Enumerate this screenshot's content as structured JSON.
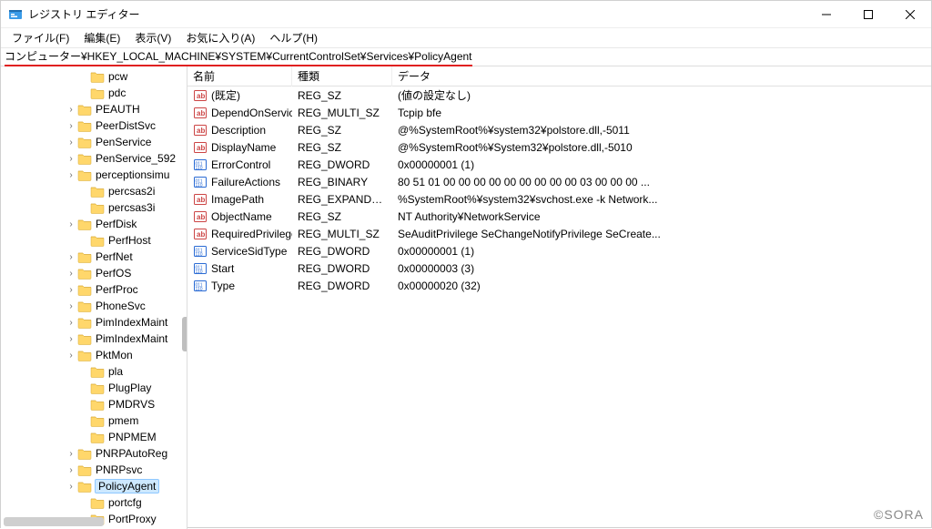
{
  "window": {
    "title": "レジストリ エディター"
  },
  "menu": {
    "file": "ファイル(F)",
    "edit": "編集(E)",
    "view": "表示(V)",
    "fav": "お気に入り(A)",
    "help": "ヘルプ(H)"
  },
  "address": "コンピューター¥HKEY_LOCAL_MACHINE¥SYSTEM¥CurrentControlSet¥Services¥PolicyAgent",
  "tree": [
    {
      "label": "pcw",
      "depth": 3,
      "chevron": ""
    },
    {
      "label": "pdc",
      "depth": 3,
      "chevron": ""
    },
    {
      "label": "PEAUTH",
      "depth": 2,
      "chevron": ">"
    },
    {
      "label": "PeerDistSvc",
      "depth": 2,
      "chevron": ">"
    },
    {
      "label": "PenService",
      "depth": 2,
      "chevron": ">"
    },
    {
      "label": "PenService_592",
      "depth": 2,
      "chevron": ">"
    },
    {
      "label": "perceptionsimu",
      "depth": 2,
      "chevron": ">"
    },
    {
      "label": "percsas2i",
      "depth": 3,
      "chevron": ""
    },
    {
      "label": "percsas3i",
      "depth": 3,
      "chevron": ""
    },
    {
      "label": "PerfDisk",
      "depth": 2,
      "chevron": ">"
    },
    {
      "label": "PerfHost",
      "depth": 3,
      "chevron": ""
    },
    {
      "label": "PerfNet",
      "depth": 2,
      "chevron": ">"
    },
    {
      "label": "PerfOS",
      "depth": 2,
      "chevron": ">"
    },
    {
      "label": "PerfProc",
      "depth": 2,
      "chevron": ">"
    },
    {
      "label": "PhoneSvc",
      "depth": 2,
      "chevron": ">"
    },
    {
      "label": "PimIndexMaint",
      "depth": 2,
      "chevron": ">"
    },
    {
      "label": "PimIndexMaint",
      "depth": 2,
      "chevron": ">"
    },
    {
      "label": "PktMon",
      "depth": 2,
      "chevron": ">"
    },
    {
      "label": "pla",
      "depth": 3,
      "chevron": ""
    },
    {
      "label": "PlugPlay",
      "depth": 3,
      "chevron": ""
    },
    {
      "label": "PMDRVS",
      "depth": 3,
      "chevron": ""
    },
    {
      "label": "pmem",
      "depth": 3,
      "chevron": ""
    },
    {
      "label": "PNPMEM",
      "depth": 3,
      "chevron": ""
    },
    {
      "label": "PNRPAutoReg",
      "depth": 2,
      "chevron": ">"
    },
    {
      "label": "PNRPsvc",
      "depth": 2,
      "chevron": ">"
    },
    {
      "label": "PolicyAgent",
      "depth": 2,
      "chevron": ">",
      "selected": true
    },
    {
      "label": "portcfg",
      "depth": 3,
      "chevron": ""
    },
    {
      "label": "PortProxy",
      "depth": 3,
      "chevron": ""
    }
  ],
  "columns": {
    "name": "名前",
    "type": "種類",
    "data": "データ"
  },
  "values": [
    {
      "icon": "str",
      "name": "(既定)",
      "type": "REG_SZ",
      "data": "(値の設定なし)"
    },
    {
      "icon": "str",
      "name": "DependOnService",
      "type": "REG_MULTI_SZ",
      "data": "Tcpip bfe"
    },
    {
      "icon": "str",
      "name": "Description",
      "type": "REG_SZ",
      "data": "@%SystemRoot%¥system32¥polstore.dll,-5011"
    },
    {
      "icon": "str",
      "name": "DisplayName",
      "type": "REG_SZ",
      "data": "@%SystemRoot%¥System32¥polstore.dll,-5010"
    },
    {
      "icon": "bin",
      "name": "ErrorControl",
      "type": "REG_DWORD",
      "data": "0x00000001 (1)"
    },
    {
      "icon": "bin",
      "name": "FailureActions",
      "type": "REG_BINARY",
      "data": "80 51 01 00 00 00 00 00 00 00 00 00 03 00 00 00 ..."
    },
    {
      "icon": "str",
      "name": "ImagePath",
      "type": "REG_EXPAND_SZ",
      "data": "%SystemRoot%¥system32¥svchost.exe -k Network..."
    },
    {
      "icon": "str",
      "name": "ObjectName",
      "type": "REG_SZ",
      "data": "NT Authority¥NetworkService"
    },
    {
      "icon": "str",
      "name": "RequiredPrivileges",
      "type": "REG_MULTI_SZ",
      "data": "SeAuditPrivilege SeChangeNotifyPrivilege SeCreate..."
    },
    {
      "icon": "bin",
      "name": "ServiceSidType",
      "type": "REG_DWORD",
      "data": "0x00000001 (1)"
    },
    {
      "icon": "bin",
      "name": "Start",
      "type": "REG_DWORD",
      "data": "0x00000003 (3)"
    },
    {
      "icon": "bin",
      "name": "Type",
      "type": "REG_DWORD",
      "data": "0x00000020 (32)"
    }
  ],
  "watermark": "©SORA"
}
